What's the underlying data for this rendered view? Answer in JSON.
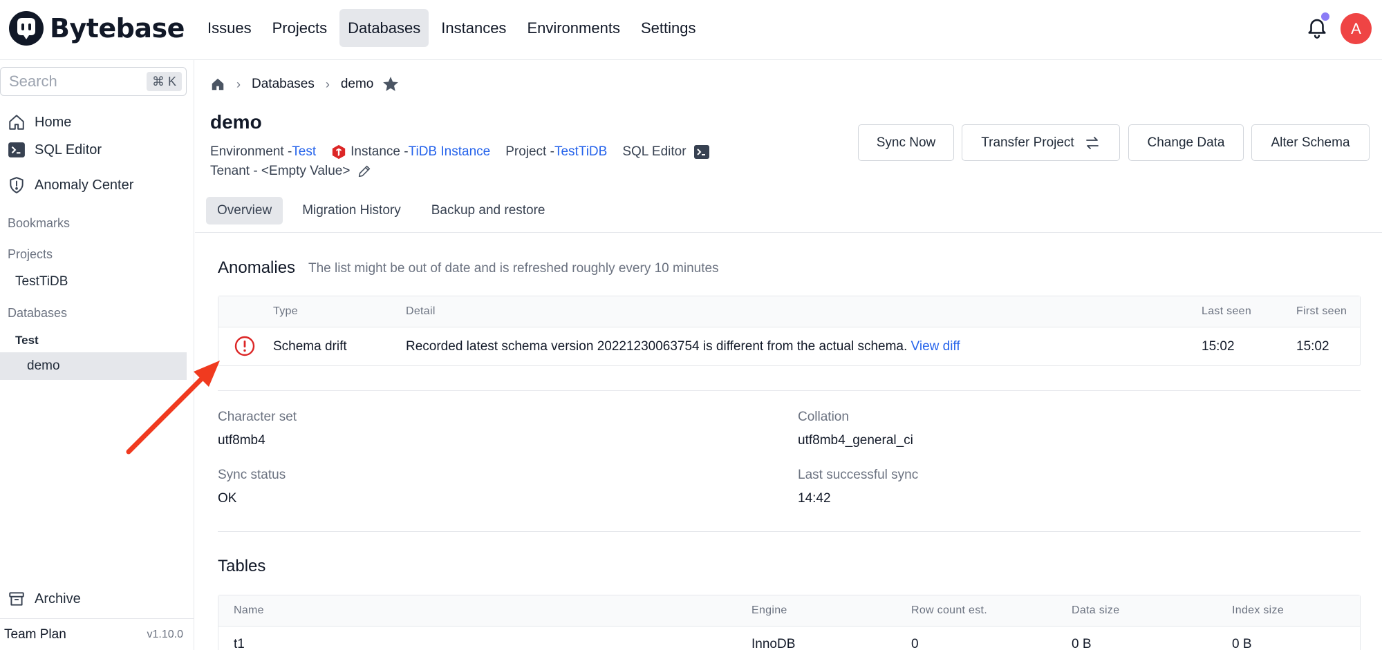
{
  "brand": {
    "name": "Bytebase"
  },
  "topnav": {
    "items": [
      {
        "label": "Issues"
      },
      {
        "label": "Projects"
      },
      {
        "label": "Databases",
        "active": true
      },
      {
        "label": "Instances"
      },
      {
        "label": "Environments"
      },
      {
        "label": "Settings"
      }
    ],
    "avatar": "A"
  },
  "sidebar": {
    "search_placeholder": "Search",
    "search_shortcut": "⌘ K",
    "home": "Home",
    "sql_editor": "SQL Editor",
    "anomaly_center": "Anomaly Center",
    "bookmarks": "Bookmarks",
    "projects_section": "Projects",
    "project_item": "TestTiDB",
    "databases_section": "Databases",
    "env_group": "Test",
    "db_item": "demo",
    "archive": "Archive",
    "plan": "Team Plan",
    "version": "v1.10.0"
  },
  "breadcrumb": {
    "databases": "Databases",
    "current": "demo"
  },
  "page": {
    "title": "demo",
    "environment_label": "Environment - ",
    "environment_value": "Test",
    "instance_label": "Instance - ",
    "instance_value": "TiDB Instance",
    "project_label": "Project - ",
    "project_value": "TestTiDB",
    "sql_editor_label": "SQL Editor",
    "tenant_label": "Tenant - <Empty Value>"
  },
  "actions": {
    "sync_now": "Sync Now",
    "transfer_project": "Transfer Project",
    "change_data": "Change Data",
    "alter_schema": "Alter Schema"
  },
  "tabs": [
    {
      "label": "Overview",
      "active": true
    },
    {
      "label": "Migration History"
    },
    {
      "label": "Backup and restore"
    }
  ],
  "anomalies": {
    "title": "Anomalies",
    "note": "The list might be out of date and is refreshed roughly every 10 minutes",
    "columns": {
      "type": "Type",
      "detail": "Detail",
      "last_seen": "Last seen",
      "first_seen": "First seen"
    },
    "rows": [
      {
        "type": "Schema drift",
        "detail": "Recorded latest schema version 20221230063754 is different from the actual schema.",
        "link": "View diff",
        "last_seen": "15:02",
        "first_seen": "15:02"
      }
    ]
  },
  "info": {
    "charset_label": "Character set",
    "charset_value": "utf8mb4",
    "collation_label": "Collation",
    "collation_value": "utf8mb4_general_ci",
    "sync_status_label": "Sync status",
    "sync_status_value": "OK",
    "last_sync_label": "Last successful sync",
    "last_sync_value": "14:42"
  },
  "tables": {
    "title": "Tables",
    "columns": {
      "name": "Name",
      "engine": "Engine",
      "rows": "Row count est.",
      "data_size": "Data size",
      "index_size": "Index size"
    },
    "rows": [
      {
        "name": "t1",
        "engine": "InnoDB",
        "rows": "0",
        "data_size": "0 B",
        "index_size": "0 B"
      }
    ]
  },
  "colors": {
    "accent": "#2563eb",
    "danger": "#dc2626",
    "avatar": "#ef4444",
    "arrow": "#f03a1f"
  }
}
